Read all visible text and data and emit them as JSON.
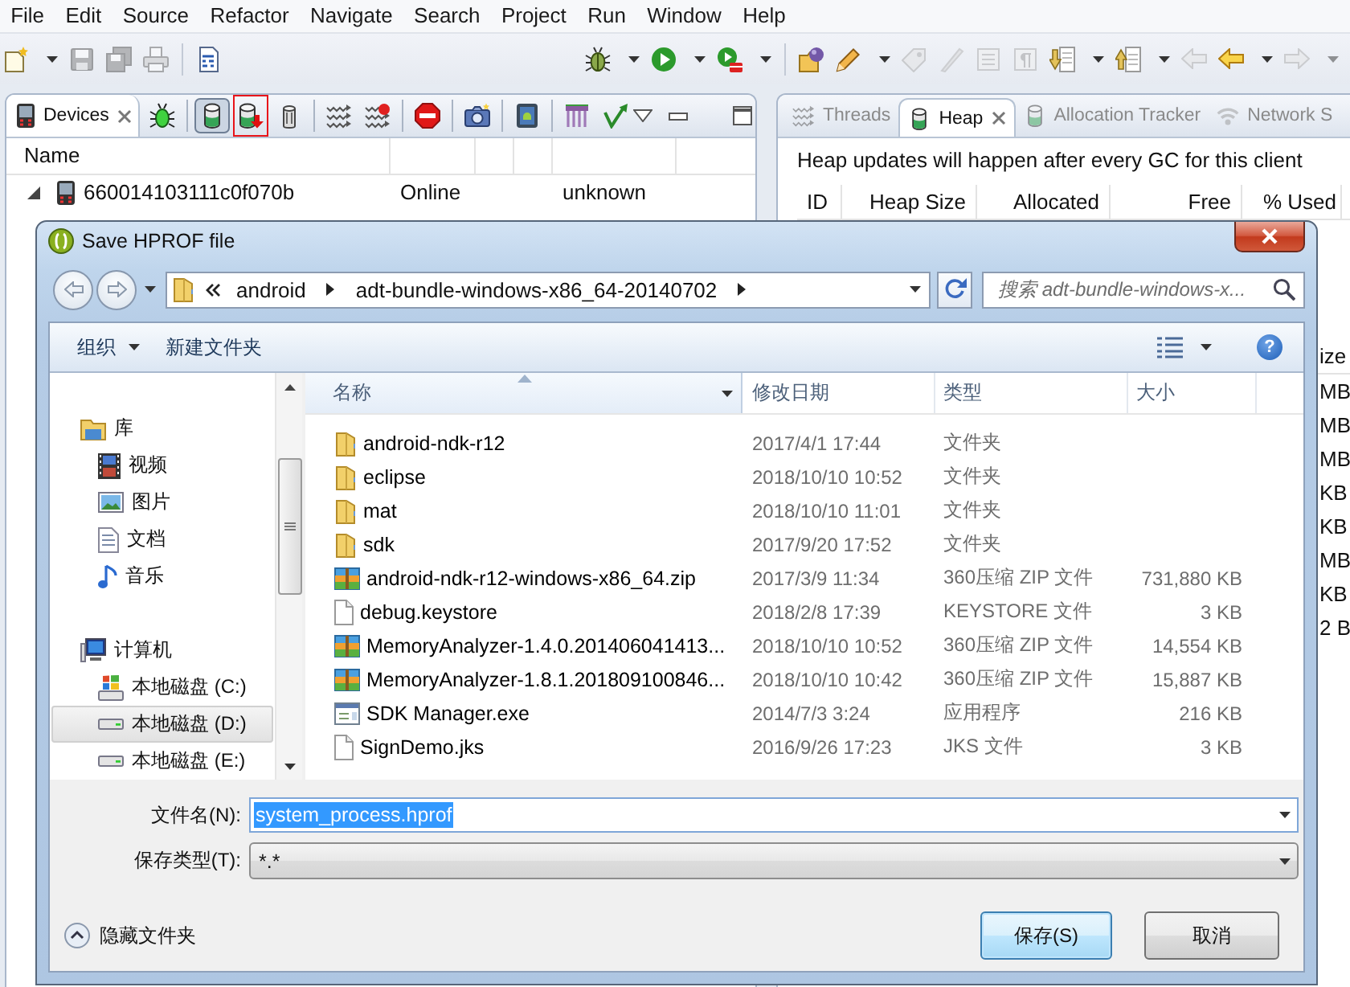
{
  "menu_bar": [
    "File",
    "Edit",
    "Source",
    "Refactor",
    "Navigate",
    "Search",
    "Project",
    "Run",
    "Window",
    "Help"
  ],
  "main_toolbar": {
    "left_groups": [
      [
        {
          "kind": "new",
          "dropdown": true,
          "disabled": false
        },
        {
          "kind": "save",
          "dropdown": false,
          "disabled": true
        },
        {
          "kind": "save-all",
          "dropdown": false,
          "disabled": true
        },
        {
          "kind": "print",
          "dropdown": false,
          "disabled": true
        }
      ],
      [
        {
          "kind": "binary",
          "dropdown": false,
          "disabled": false
        }
      ]
    ],
    "right_groups": [
      [
        {
          "kind": "debug",
          "dropdown": true,
          "disabled": false
        },
        {
          "kind": "run",
          "dropdown": true,
          "disabled": false
        },
        {
          "kind": "external",
          "dropdown": true,
          "disabled": false
        }
      ],
      [
        {
          "kind": "open-type",
          "dropdown": false,
          "disabled": false
        },
        {
          "kind": "pencil",
          "dropdown": true,
          "disabled": false
        },
        {
          "kind": "tag",
          "dropdown": false,
          "disabled": true
        },
        {
          "kind": "marker",
          "dropdown": false,
          "disabled": true
        },
        {
          "kind": "block",
          "dropdown": false,
          "disabled": true
        },
        {
          "kind": "pilcrow",
          "dropdown": false,
          "disabled": true
        },
        {
          "kind": "next-annotation",
          "dropdown": true,
          "disabled": false
        },
        {
          "kind": "prev-annotation",
          "dropdown": true,
          "disabled": false
        },
        {
          "kind": "last-edit",
          "dropdown": false,
          "disabled": true
        },
        {
          "kind": "back",
          "dropdown": true,
          "disabled": false
        },
        {
          "kind": "forward",
          "dropdown": true,
          "disabled": true
        }
      ]
    ]
  },
  "devices_panel": {
    "tabs": [
      {
        "label": "Devices",
        "selected": true
      }
    ],
    "toolbar": [
      [
        {
          "kind": "debug-process",
          "pressed": false,
          "highlighted": false
        }
      ],
      [
        {
          "kind": "update-heap",
          "pressed": true,
          "highlighted": false
        },
        {
          "kind": "dump-hprof",
          "pressed": false,
          "highlighted": true
        },
        {
          "kind": "gc",
          "pressed": false,
          "highlighted": false
        }
      ],
      [
        {
          "kind": "update-threads",
          "pressed": false,
          "highlighted": false
        },
        {
          "kind": "start-profiling",
          "pressed": false,
          "highlighted": false
        }
      ],
      [
        {
          "kind": "stop",
          "pressed": false,
          "highlighted": false
        }
      ],
      [
        {
          "kind": "screen-capture",
          "pressed": false,
          "highlighted": false
        }
      ],
      [
        {
          "kind": "device-view",
          "pressed": false,
          "highlighted": false
        }
      ],
      [
        {
          "kind": "systrace",
          "pressed": false,
          "highlighted": false
        },
        {
          "kind": "open-gl-trace",
          "pressed": false,
          "highlighted": false
        }
      ]
    ],
    "columns": [
      "Name"
    ],
    "rows": [
      {
        "name": "660014103111c0f070b",
        "expanded": true,
        "column_2": "Online",
        "column_5": "unknown"
      }
    ]
  },
  "heap_panel": {
    "tabs": [
      {
        "label": "Threads",
        "kind": "threads",
        "selected": false
      },
      {
        "label": "Heap",
        "kind": "heap",
        "selected": true
      },
      {
        "label": "Allocation Tracker",
        "kind": "allocation",
        "selected": false
      },
      {
        "label": "Network S",
        "kind": "network",
        "selected": false
      }
    ],
    "message": "Heap updates will happen after every GC for this client",
    "columns": [
      "ID",
      "Heap Size",
      "Allocated",
      "Free",
      "% Used"
    ],
    "lower_table": {
      "column_fragment": "ize",
      "cell_fragments": [
        "MB",
        "MB",
        "MB",
        "KB",
        "KB",
        "MB",
        "KB",
        "2 B"
      ]
    }
  },
  "dialog": {
    "title": "Save HPROF file",
    "address": {
      "path": [
        "android",
        "adt-bundle-windows-x86_64-20140702"
      ],
      "search_placeholder": "搜索 adt-bundle-windows-x..."
    },
    "toolbar": {
      "organize": "组织",
      "new_folder": "新建文件夹",
      "help": "?"
    },
    "navigation": [
      {
        "label": "库",
        "kind": "library",
        "selected": false,
        "children": [
          {
            "label": "视频",
            "kind": "videos",
            "selected": false
          },
          {
            "label": "图片",
            "kind": "pictures",
            "selected": false
          },
          {
            "label": "文档",
            "kind": "documents",
            "selected": false
          },
          {
            "label": "音乐",
            "kind": "music",
            "selected": false
          }
        ]
      },
      {
        "label": "计算机",
        "kind": "computer",
        "selected": false,
        "children": [
          {
            "label": "本地磁盘 (C:)",
            "kind": "system-drive",
            "selected": false
          },
          {
            "label": "本地磁盘 (D:)",
            "kind": "drive",
            "selected": true
          },
          {
            "label": "本地磁盘 (E:)",
            "kind": "drive",
            "selected": false
          }
        ]
      }
    ],
    "columns": [
      {
        "label": "名称",
        "sorted": true,
        "hovered": true
      },
      {
        "label": "修改日期",
        "sorted": false,
        "hovered": false
      },
      {
        "label": "类型",
        "sorted": false,
        "hovered": false
      },
      {
        "label": "大小",
        "sorted": false,
        "hovered": false
      }
    ],
    "files": [
      {
        "name": "android-ndk-r12",
        "kind": "folder",
        "modified": "2017/4/1 17:44",
        "type": "文件夹"
      },
      {
        "name": "eclipse",
        "kind": "folder",
        "modified": "2018/10/10 10:52",
        "type": "文件夹"
      },
      {
        "name": "mat",
        "kind": "folder",
        "modified": "2018/10/10 11:01",
        "type": "文件夹"
      },
      {
        "name": "sdk",
        "kind": "folder",
        "modified": "2017/9/20 17:52",
        "type": "文件夹"
      },
      {
        "name": "android-ndk-r12-windows-x86_64.zip",
        "kind": "archive",
        "modified": "2017/3/9 11:34",
        "type": "360压缩 ZIP 文件",
        "size": "731,880 KB"
      },
      {
        "name": "debug.keystore",
        "kind": "file",
        "modified": "2018/2/8 17:39",
        "type": "KEYSTORE 文件",
        "size": "3 KB"
      },
      {
        "name": "MemoryAnalyzer-1.4.0.201406041413...",
        "kind": "archive",
        "modified": "2018/10/10 10:52",
        "type": "360压缩 ZIP 文件",
        "size": "14,554 KB"
      },
      {
        "name": "MemoryAnalyzer-1.8.1.201809100846...",
        "kind": "archive",
        "modified": "2018/10/10 10:42",
        "type": "360压缩 ZIP 文件",
        "size": "15,887 KB"
      },
      {
        "name": "SDK Manager.exe",
        "kind": "program",
        "modified": "2014/7/3 3:24",
        "type": "应用程序",
        "size": "216 KB"
      },
      {
        "name": "SignDemo.jks",
        "kind": "file",
        "modified": "2016/9/26 17:23",
        "type": "JKS 文件",
        "size": "3 KB"
      }
    ],
    "file_name": {
      "label": "文件名(N):",
      "value": "system_process.hprof",
      "text_selected": true
    },
    "file_type": {
      "label": "保存类型(T):",
      "value": "*.*"
    },
    "hide_folders": "隐藏文件夹",
    "buttons": [
      {
        "label": "保存(S)",
        "default": true
      },
      {
        "label": "取消",
        "default": false
      }
    ]
  }
}
